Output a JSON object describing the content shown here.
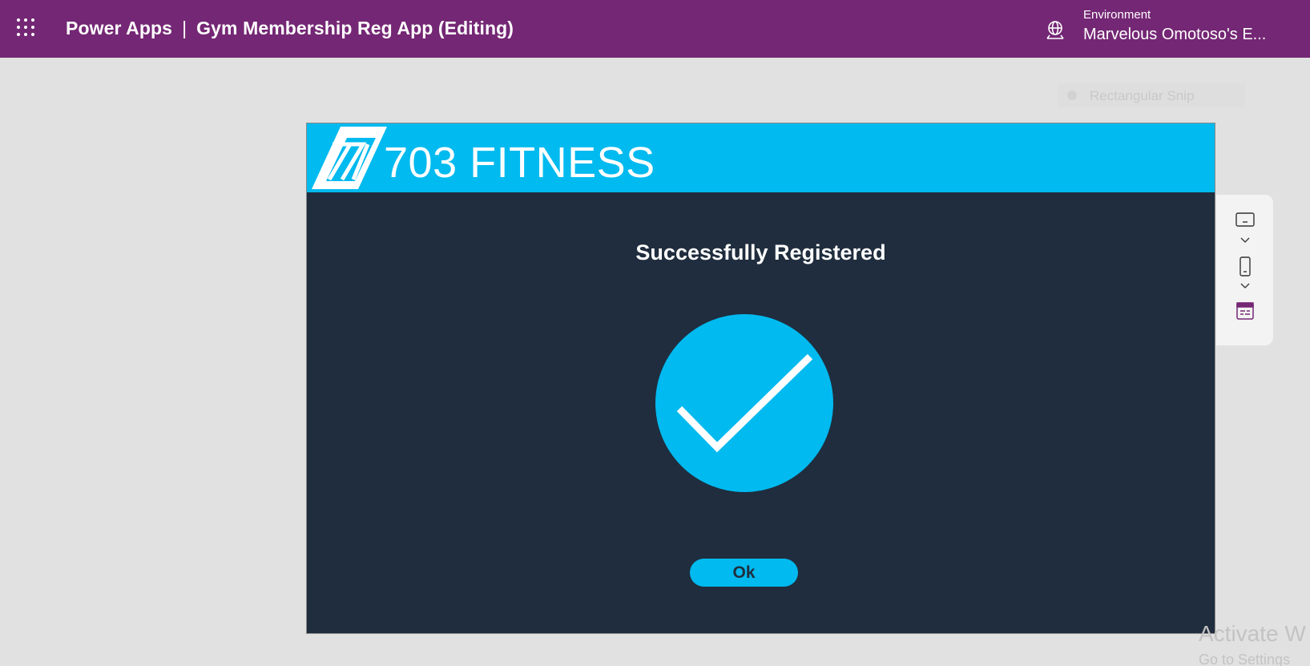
{
  "topbar": {
    "brand": "Power Apps",
    "separator": "|",
    "app_name": "Gym Membership Reg App (Editing)",
    "environment_label": "Environment",
    "environment_name": "Marvelous Omotoso's E...",
    "icons": [
      "waffle-icon",
      "globe-icon"
    ],
    "color": "#742774"
  },
  "snip_tooltip": {
    "label": "Rectangular Snip"
  },
  "canvas": {
    "brand_name": "703 FITNESS",
    "logo": "703-logo",
    "message": "Successfully Registered",
    "status_icon": "check-circle-icon",
    "ok_button": "Ok",
    "colors": {
      "header": "#01baef",
      "background": "#1f2d3e",
      "accent": "#01baef"
    }
  },
  "side_panel": {
    "icons": [
      "tablet-icon",
      "chevron-down-icon",
      "phone-icon",
      "chevron-down-icon",
      "layout-icon"
    ]
  },
  "watermark": {
    "title": "Activate W",
    "subtitle": "Go to Settings"
  }
}
